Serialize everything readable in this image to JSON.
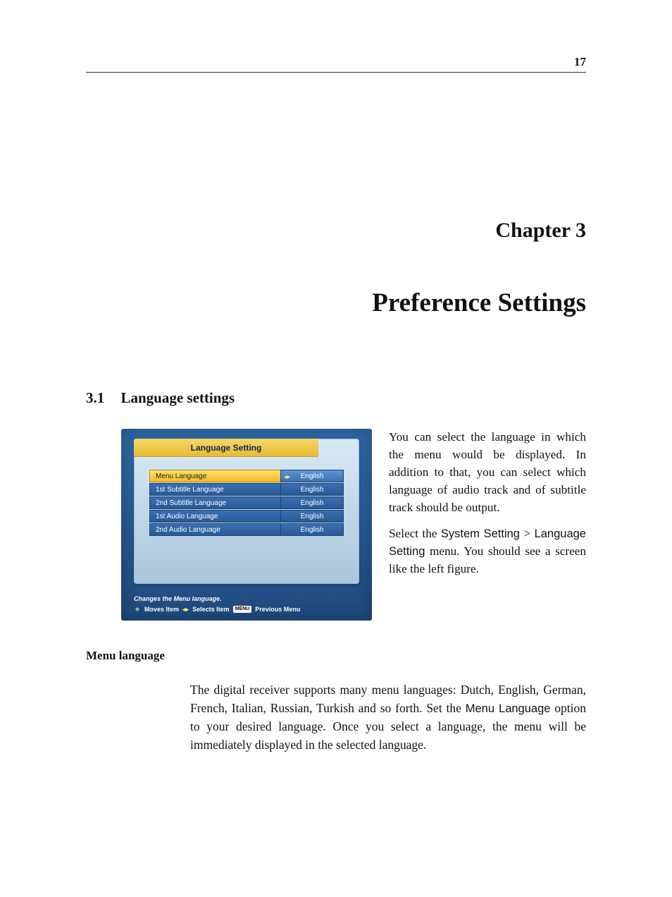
{
  "page_number": "17",
  "chapter": {
    "label": "Chapter 3",
    "title": "Preference Settings"
  },
  "section": {
    "number": "3.1",
    "title": "Language settings"
  },
  "figure": {
    "panel_title": "Language Setting",
    "rows": [
      {
        "label": "Menu Language",
        "value": "English",
        "selected": true,
        "lr_glyph": "◂▸"
      },
      {
        "label": "1st Subtitle Language",
        "value": "English",
        "selected": false
      },
      {
        "label": "2nd Subtitle Language",
        "value": "English",
        "selected": false
      },
      {
        "label": "1st Audio Language",
        "value": "English",
        "selected": false
      },
      {
        "label": "2nd Audio Language",
        "value": "English",
        "selected": false
      }
    ],
    "hint_line1": "Changes the Menu language.",
    "hint_moves": "Moves Item",
    "hint_selects": "Selects Item",
    "hint_menu_badge": "MENU",
    "hint_prev": "Previous Menu"
  },
  "para": {
    "p1": "You can select the language in which the menu would be dis­played. In addition to that, you can select which language of au­dio track and of subtitle track should be output.",
    "p2a": "Select the ",
    "p2_ui1": "System Setting",
    "p2_gt": " > ",
    "p2_ui2": "Lan­guage Setting",
    "p2b": " menu. You should see a screen like the left figure."
  },
  "subhead": "Menu language",
  "body": {
    "t1": "The digital receiver supports many menu languages: Dutch, English, German, French, Italian, Russian, Turkish and so forth. Set the ",
    "ui1": "Menu Language",
    "t2": " option to your desired language. Once you select a language, the menu will be immediately displayed in the selected language."
  }
}
